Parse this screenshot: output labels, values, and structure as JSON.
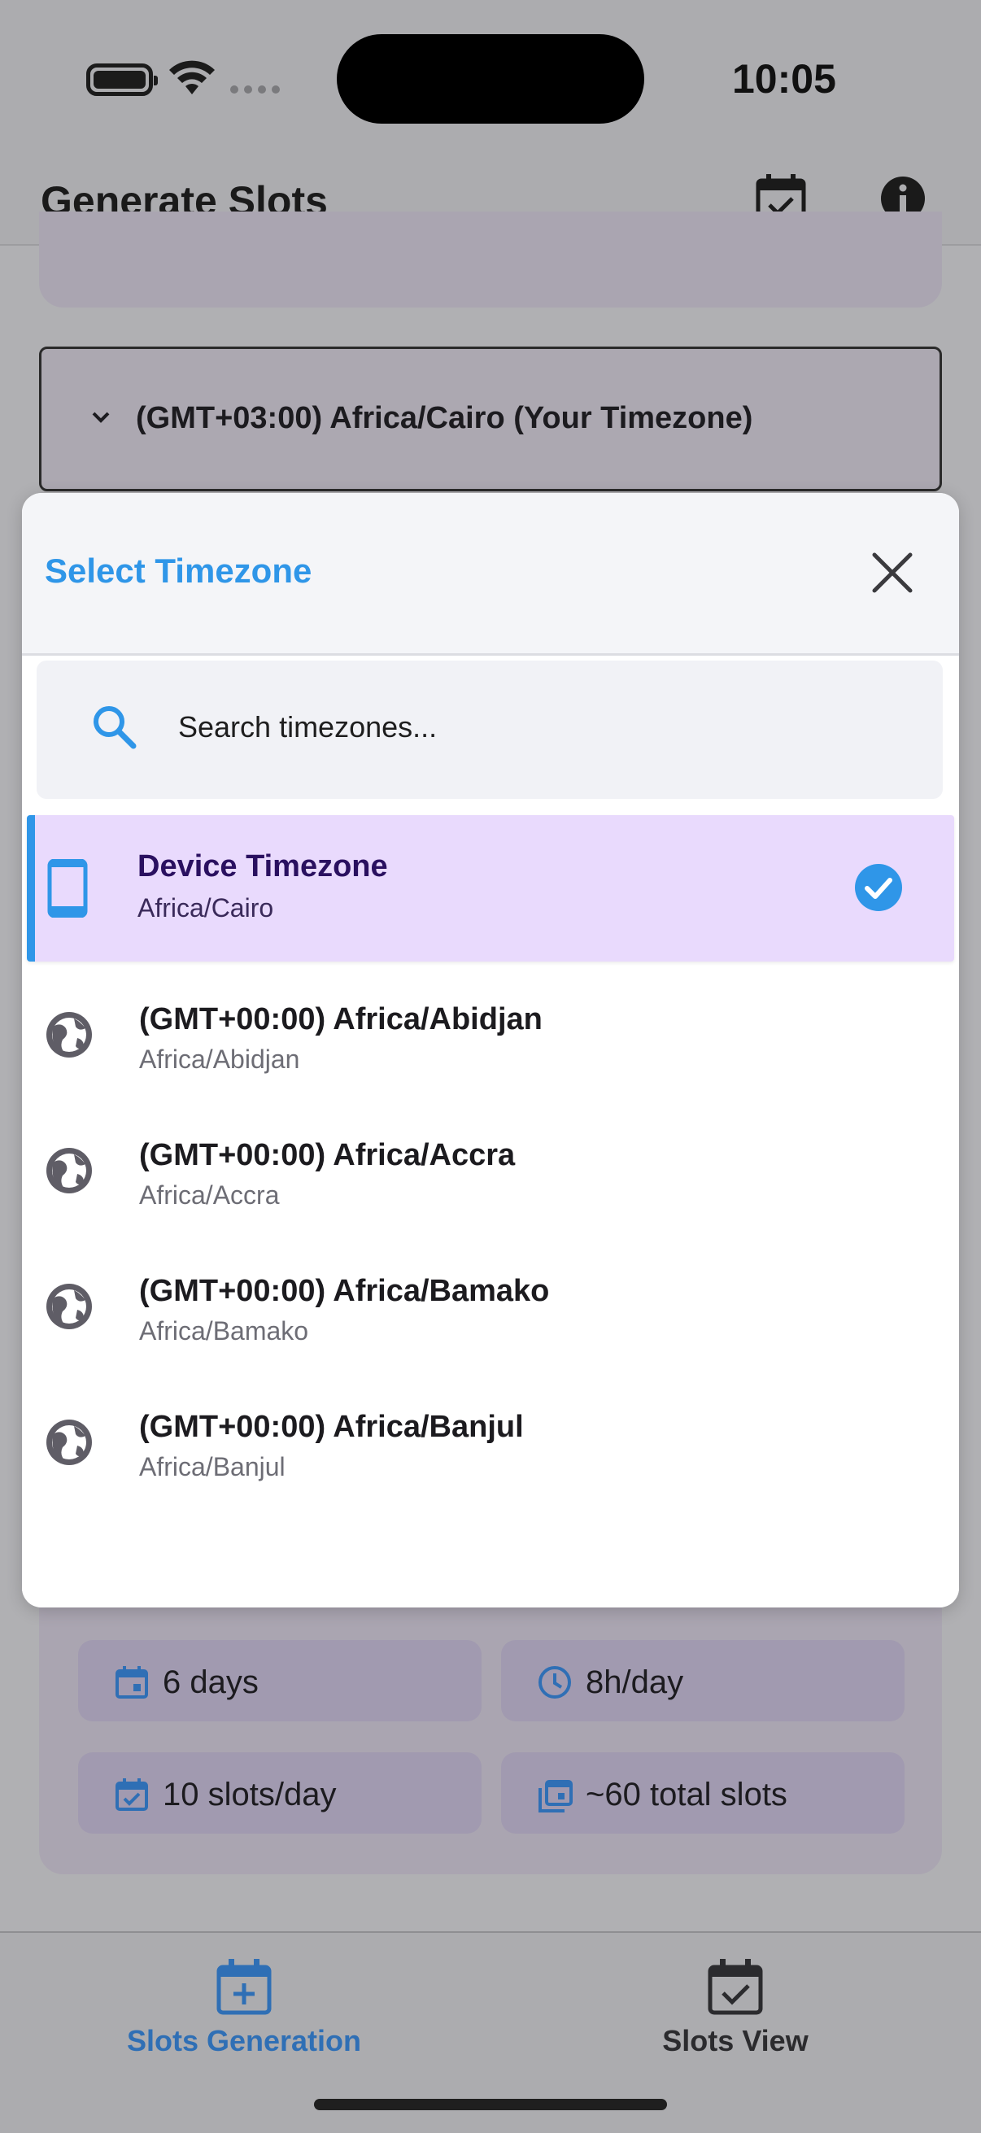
{
  "status_bar": {
    "time": "10:05"
  },
  "app_bar": {
    "title": "Generate Slots"
  },
  "timezone_dropdown": {
    "value": "(GMT+03:00) Africa/Cairo (Your Timezone)"
  },
  "modal": {
    "title": "Select Timezone",
    "search": {
      "placeholder": "Search timezones...",
      "value": ""
    },
    "device_option": {
      "title": "Device Timezone",
      "subtitle": "Africa/Cairo",
      "selected": true
    },
    "timezones": [
      {
        "title": "(GMT+00:00) Africa/Abidjan",
        "subtitle": "Africa/Abidjan"
      },
      {
        "title": "(GMT+00:00) Africa/Accra",
        "subtitle": "Africa/Accra"
      },
      {
        "title": "(GMT+00:00) Africa/Bamako",
        "subtitle": "Africa/Bamako"
      },
      {
        "title": "(GMT+00:00) Africa/Banjul",
        "subtitle": "Africa/Banjul"
      }
    ]
  },
  "summary_chips": [
    {
      "label": "6 days",
      "icon": "calendar-icon"
    },
    {
      "label": "8h/day",
      "icon": "clock-icon"
    },
    {
      "label": "10 slots/day",
      "icon": "calendar-check-icon"
    },
    {
      "label": "~60 total slots",
      "icon": "calendar-stack-icon"
    }
  ],
  "bottom_nav": [
    {
      "label": "Slots Generation",
      "icon": "calendar-plus-icon",
      "active": true
    },
    {
      "label": "Slots View",
      "icon": "calendar-check-icon",
      "active": false
    }
  ],
  "colors": {
    "accent": "#2f96e8",
    "selected_bg": "#e9dafd",
    "scrim": "#b0b0b3"
  }
}
